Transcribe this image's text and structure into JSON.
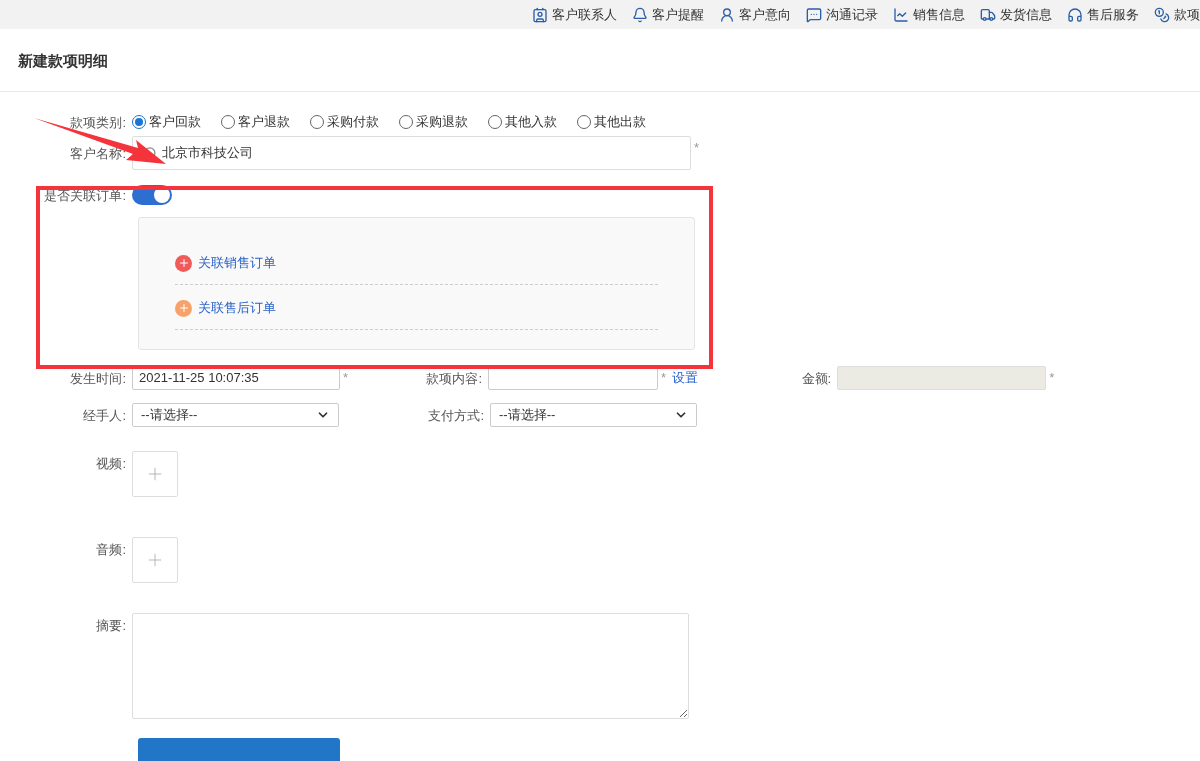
{
  "top_nav": [
    {
      "label": "客户联系人"
    },
    {
      "label": "客户提醒"
    },
    {
      "label": "客户意向"
    },
    {
      "label": "沟通记录"
    },
    {
      "label": "销售信息"
    },
    {
      "label": "发货信息"
    },
    {
      "label": "售后服务"
    },
    {
      "label": "款项"
    }
  ],
  "title": "新建款项明细",
  "category": {
    "label": "款项类别:",
    "options": [
      {
        "label": "客户回款",
        "selected": true
      },
      {
        "label": "客户退款",
        "selected": false
      },
      {
        "label": "采购付款",
        "selected": false
      },
      {
        "label": "采购退款",
        "selected": false
      },
      {
        "label": "其他入款",
        "selected": false
      },
      {
        "label": "其他出款",
        "selected": false
      }
    ]
  },
  "customer": {
    "label": "客户名称:",
    "value": "北京市科技公司",
    "mark": "*"
  },
  "link_order": {
    "label": "是否关联订单:",
    "on": true,
    "links": [
      {
        "label": "关联销售订单",
        "color": "#f25a5a"
      },
      {
        "label": "关联售后订单",
        "color": "#f7a26a"
      }
    ]
  },
  "occurred": {
    "label": "发生时间:",
    "value": "2021-11-25 10:07:35",
    "mark": "*"
  },
  "content": {
    "label": "款项内容:",
    "mark": "*",
    "link": "设置"
  },
  "amount": {
    "label": "金额:",
    "disabled": true,
    "mark": "*"
  },
  "handler": {
    "label": "经手人:",
    "value": "--请选择--"
  },
  "payment": {
    "label": "支付方式:",
    "value": "--请选择--"
  },
  "video": {
    "label": "视频:"
  },
  "audio": {
    "label": "音频:"
  },
  "summary": {
    "label": "摘要:"
  }
}
